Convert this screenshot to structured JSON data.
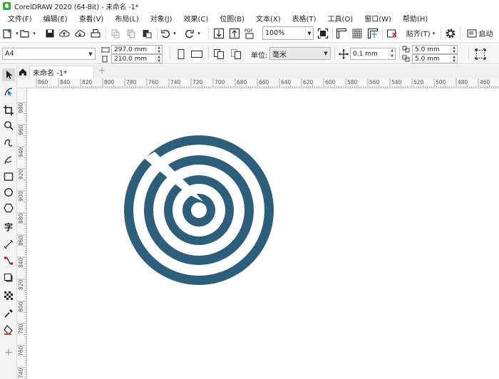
{
  "window": {
    "title": "CorelDRAW 2020 (64-Bit) - 未命名 -1*"
  },
  "menu": [
    "文件(F)",
    "编辑(E)",
    "查看(V)",
    "布局(L)",
    "对象(J)",
    "效果(C)",
    "位图(B)",
    "文本(X)",
    "表格(T)",
    "工具(O)",
    "窗口(W)",
    "帮助(H)"
  ],
  "toolbar": {
    "zoom": "100%",
    "snap_label": "贴齐(T)",
    "launch_label": "启动"
  },
  "properties": {
    "page_size": "A4",
    "width": "297.0 mm",
    "height": "210.0 mm",
    "unit_label": "单位:",
    "unit_value": "毫米",
    "nudge": "0.1 mm",
    "dup_x": "5.0 mm",
    "dup_y": "5.0 mm"
  },
  "tabs": {
    "document": "未命名 -1*"
  },
  "ruler": {
    "h_labels": [
      "860",
      "840",
      "820",
      "800",
      "780",
      "760",
      "740",
      "720",
      "700",
      "680",
      "660",
      "640",
      "620",
      "600",
      "580",
      "560",
      "540",
      "520",
      "500",
      "480",
      "460"
    ],
    "v_labels": [
      "980",
      "960",
      "940",
      "920",
      "900",
      "880",
      "860",
      "840",
      "820",
      "800",
      "780",
      "760",
      "740"
    ]
  },
  "colors": {
    "target": "#2d5e7a",
    "accent": "#1a73c8"
  }
}
